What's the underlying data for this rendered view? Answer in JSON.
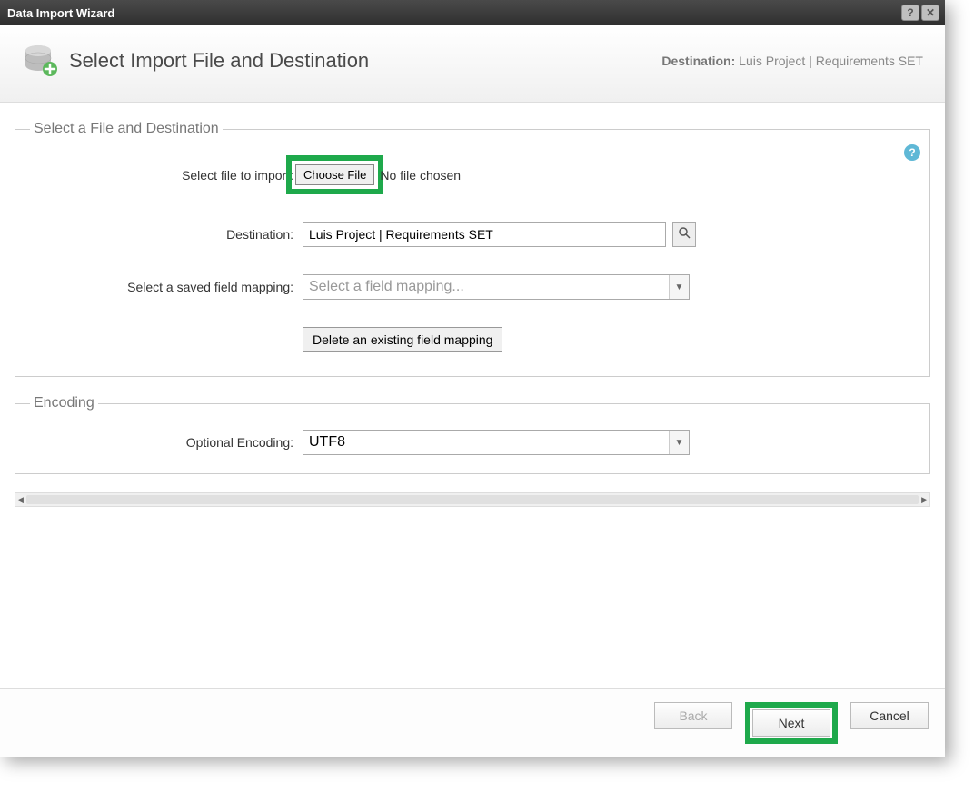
{
  "titlebar": {
    "title": "Data Import Wizard"
  },
  "header": {
    "title": "Select Import File and Destination",
    "dest_label": "Destination:",
    "dest_value": "Luis Project | Requirements SET"
  },
  "section_file": {
    "legend": "Select a File and Destination",
    "file_label": "Select file to import:",
    "choose_btn": "Choose File",
    "file_status": "No file chosen",
    "dest_label": "Destination:",
    "dest_value": "Luis Project | Requirements SET",
    "mapping_label": "Select a saved field mapping:",
    "mapping_placeholder": "Select a field mapping...",
    "delete_mapping_btn": "Delete an existing field mapping"
  },
  "section_encoding": {
    "legend": "Encoding",
    "encoding_label": "Optional Encoding:",
    "encoding_value": "UTF8"
  },
  "footer": {
    "back": "Back",
    "next": "Next",
    "cancel": "Cancel"
  }
}
